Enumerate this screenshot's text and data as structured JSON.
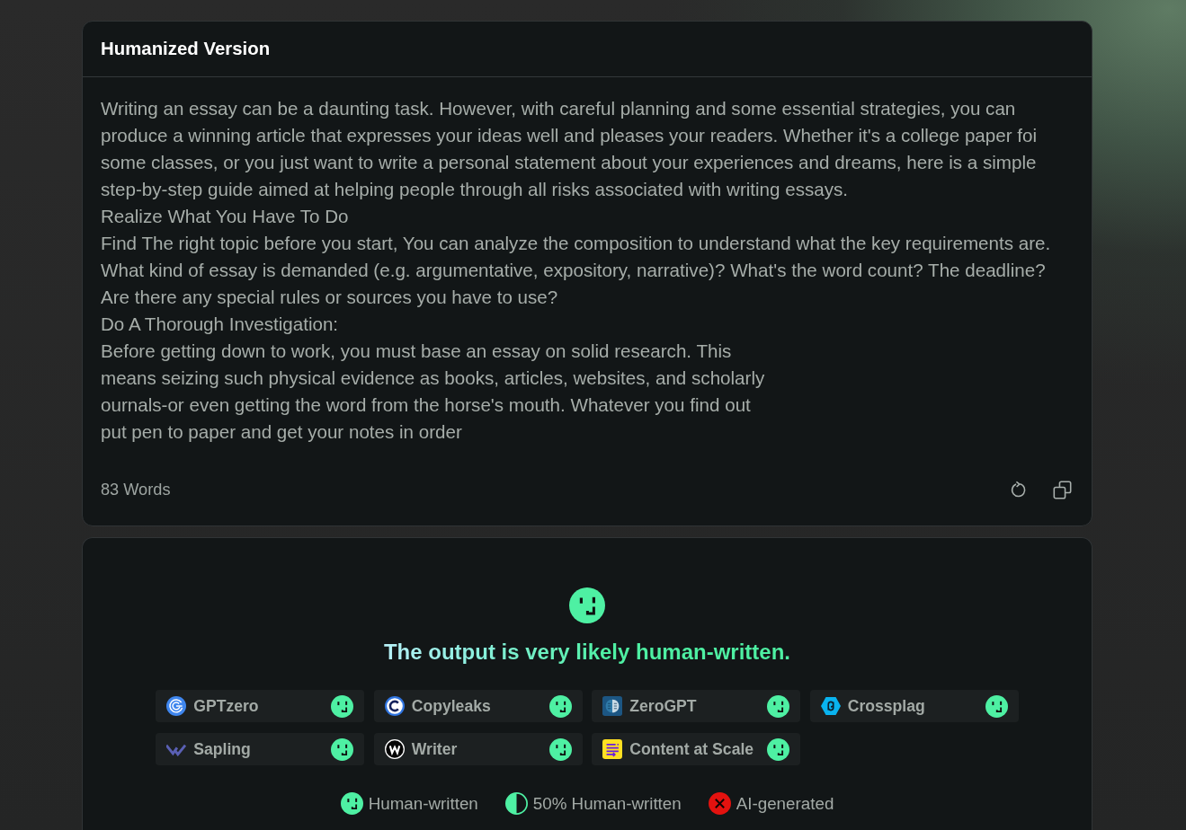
{
  "editor": {
    "title": "Humanized Version",
    "paragraphs": [
      "Writing an essay can be a daunting task. However, with careful planning and some essential strategies, you can produce a winning article that expresses your ideas well and pleases your readers. Whether it's a college paper foi some classes, or you just want to write a personal statement about your experiences and dreams, here is a simple step-by-step guide aimed at helping people through all risks associated with writing essays.",
      "Realize What You Have To Do",
      "Find The right topic before you start, You can analyze the composition to understand what the key requirements are. What kind of essay is demanded (e.g. argumentative, expository, narrative)? What's the word count? The deadline? Are there any special rules or sources you have to use?",
      "Do A Thorough Investigation:",
      "Before getting down to work, you must base an essay on solid research. This\nmeans seizing such physical evidence as books, articles, websites, and scholarly\nournals-or even getting the word from the horse's mouth. Whatever you find out\nput pen to paper and get your notes in order"
    ],
    "word_count": "83 Words"
  },
  "result": {
    "verdict": {
      "kind": "human"
    },
    "headline": "The output is very likely human-written.",
    "detectors": [
      {
        "name": "GPTzero",
        "kind": "spiral",
        "verdict": {
          "kind": "human"
        }
      },
      {
        "name": "Copyleaks",
        "kind": "ring",
        "verdict": {
          "kind": "human"
        }
      },
      {
        "name": "ZeroGPT",
        "kind": "brain",
        "verdict": {
          "kind": "human"
        }
      },
      {
        "name": "Crossplag",
        "kind": "hexagon",
        "verdict": {
          "kind": "human"
        }
      },
      {
        "name": "Sapling",
        "kind": "chevron",
        "verdict": {
          "kind": "human"
        }
      },
      {
        "name": "Writer",
        "kind": "zigzag",
        "verdict": {
          "kind": "human"
        }
      },
      {
        "name": "Content at Scale",
        "kind": "lines",
        "verdict": {
          "kind": "human"
        }
      }
    ],
    "legend": [
      {
        "kind": "human",
        "label": "Human-written"
      },
      {
        "kind": "half",
        "label": "50% Human-written"
      },
      {
        "kind": "ai",
        "label": "AI-generated"
      }
    ]
  }
}
